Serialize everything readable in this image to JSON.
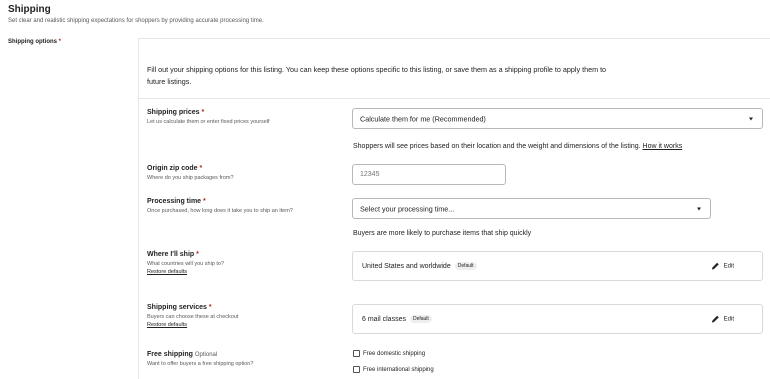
{
  "section": {
    "title": "Shipping",
    "subtitle": "Set clear and realistic shipping expectations for shoppers by providing accurate processing time.",
    "options_label": "Shipping options",
    "required_mark": "*"
  },
  "intro": "Fill out your shipping options for this listing. You can keep these options specific to this listing, or save them as a shipping profile to apply them to future listings.",
  "shipping_prices": {
    "title": "Shipping prices",
    "subtitle": "Let us calculate them or enter fixed prices yourself",
    "selected": "Calculate them for me (Recommended)",
    "hint": "Shoppers will see prices based on their location and the weight and dimensions of the listing.",
    "hint_link": "How it works"
  },
  "origin_zip": {
    "title": "Origin zip code",
    "subtitle": "Where do you ship packages from?",
    "placeholder": "12345"
  },
  "processing_time": {
    "title": "Processing time",
    "subtitle": "Once purchased, how long does it take you to ship an item?",
    "selected": "Select your processing time...",
    "hint": "Buyers are more likely to purchase items that ship quickly"
  },
  "where_ship": {
    "title": "Where I'll ship",
    "subtitle": "What countries will you ship to?",
    "restore": "Restore defaults",
    "value": "United States and worldwide",
    "badge": "Default",
    "edit": "Edit"
  },
  "shipping_services": {
    "title": "Shipping services",
    "subtitle": "Buyers can choose these at checkout",
    "restore": "Restore defaults",
    "value": "6 mail classes",
    "badge": "Default",
    "edit": "Edit"
  },
  "free_shipping": {
    "title": "Free shipping",
    "optional": "Optional",
    "subtitle": "Want to offer buyers a free shipping option?",
    "domestic": "Free domestic shipping",
    "international": "Free international shipping"
  }
}
